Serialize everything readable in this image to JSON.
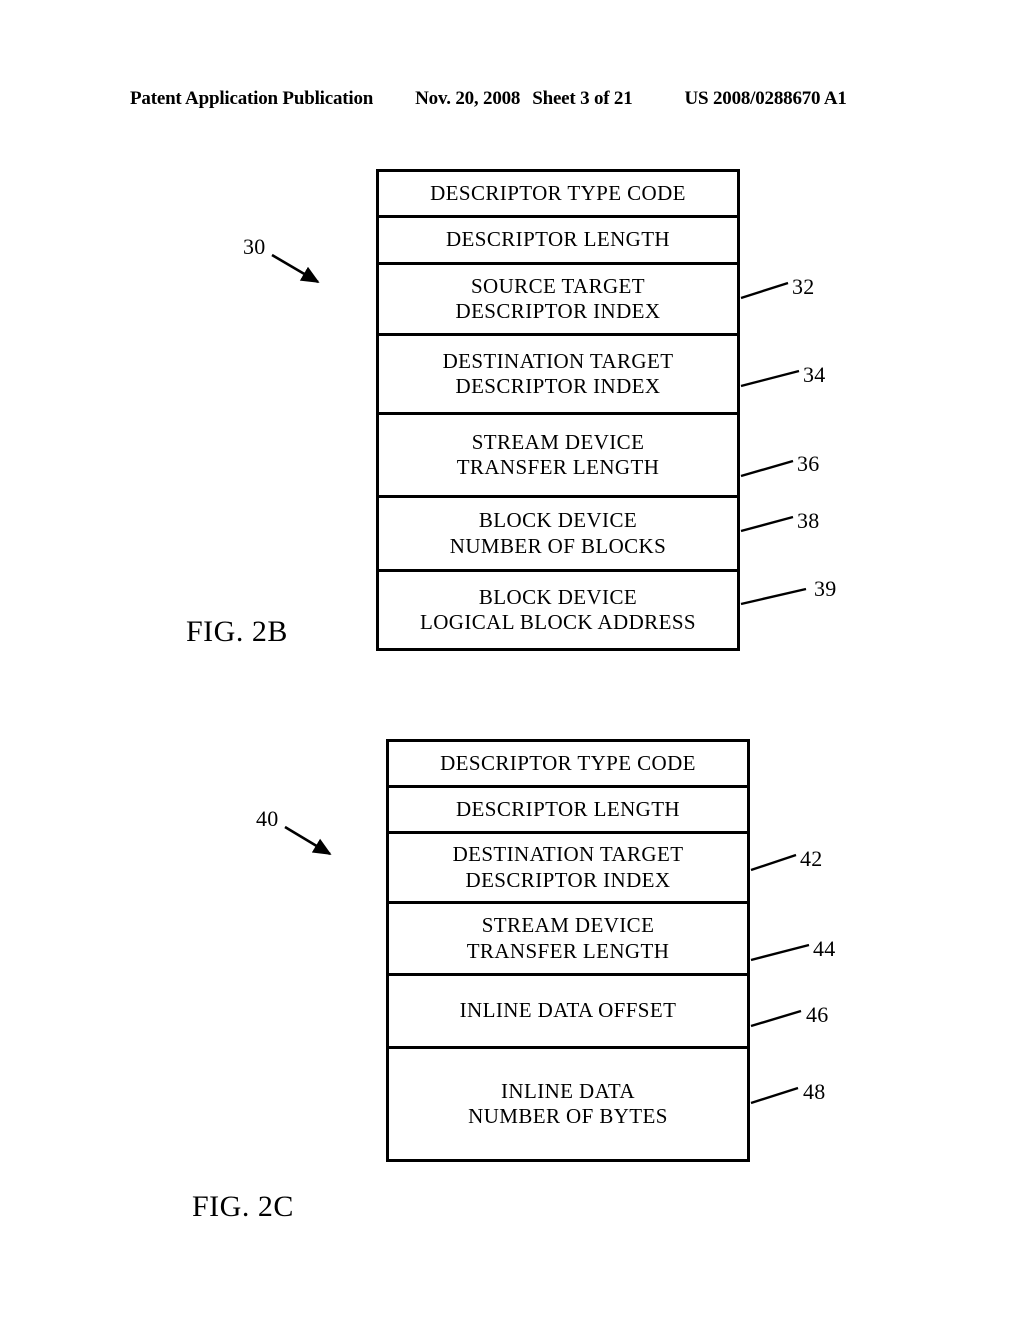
{
  "header": {
    "publication": "Patent Application Publication",
    "date": "Nov. 20, 2008",
    "sheet": "Sheet 3 of 21",
    "patent_number": "US 2008/0288670 A1"
  },
  "figures": [
    {
      "caption": "FIG. 2B",
      "figure_ref": "30",
      "rows": [
        {
          "lines": [
            "DESCRIPTOR TYPE CODE"
          ],
          "ref": ""
        },
        {
          "lines": [
            "DESCRIPTOR LENGTH"
          ],
          "ref": ""
        },
        {
          "lines": [
            "SOURCE TARGET",
            "DESCRIPTOR INDEX"
          ],
          "ref": "32"
        },
        {
          "lines": [
            "DESTINATION TARGET",
            "DESCRIPTOR INDEX"
          ],
          "ref": "34"
        },
        {
          "lines": [
            "STREAM DEVICE",
            "TRANSFER LENGTH"
          ],
          "ref": "36"
        },
        {
          "lines": [
            "BLOCK DEVICE",
            "NUMBER OF BLOCKS"
          ],
          "ref": "38"
        },
        {
          "lines": [
            "BLOCK DEVICE",
            "LOGICAL BLOCK ADDRESS"
          ],
          "ref": "39"
        }
      ]
    },
    {
      "caption": "FIG. 2C",
      "figure_ref": "40",
      "rows": [
        {
          "lines": [
            "DESCRIPTOR TYPE CODE"
          ],
          "ref": ""
        },
        {
          "lines": [
            "DESCRIPTOR LENGTH"
          ],
          "ref": ""
        },
        {
          "lines": [
            "DESTINATION TARGET",
            "DESCRIPTOR INDEX"
          ],
          "ref": "42"
        },
        {
          "lines": [
            "STREAM DEVICE",
            "TRANSFER LENGTH"
          ],
          "ref": "44"
        },
        {
          "lines": [
            "INLINE DATA OFFSET"
          ],
          "ref": "46"
        },
        {
          "lines": [
            "INLINE DATA",
            "NUMBER OF BYTES"
          ],
          "ref": "48"
        }
      ]
    }
  ],
  "colors": {
    "ink": "#000000",
    "paper": "#ffffff"
  }
}
